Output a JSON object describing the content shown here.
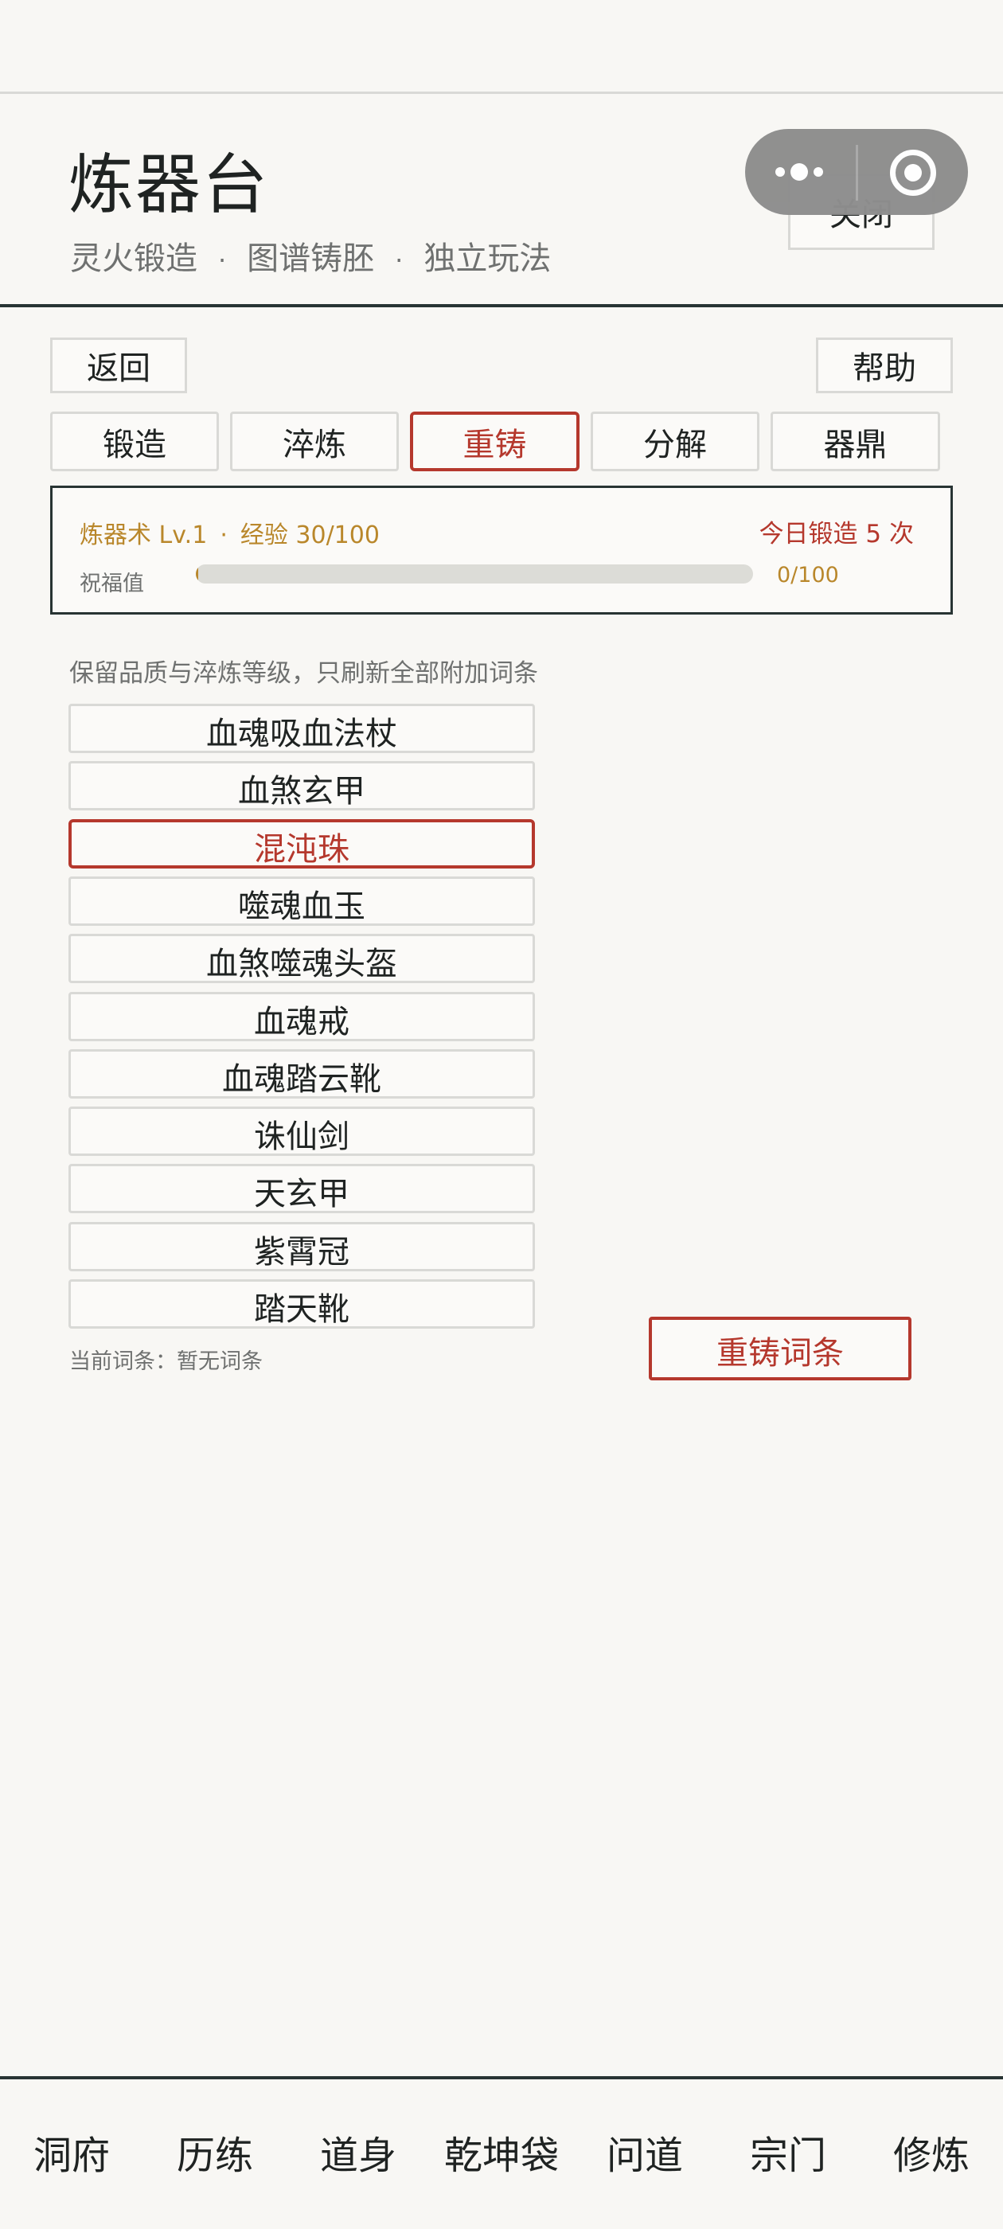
{
  "header": {
    "title": "炼器台",
    "subtitle_parts": [
      "灵火锻造",
      "图谱铸胚",
      "独立玩法"
    ],
    "separator": "·",
    "close_label": "关闭"
  },
  "capsule": {
    "more_icon": "more-dots-icon",
    "close_icon": "target-circle-icon"
  },
  "nav_buttons": {
    "back_label": "返回",
    "help_label": "帮助"
  },
  "tabs": [
    {
      "label": "锻造",
      "active": false
    },
    {
      "label": "淬炼",
      "active": false
    },
    {
      "label": "重铸",
      "active": true
    },
    {
      "label": "分解",
      "active": false
    },
    {
      "label": "器鼎",
      "active": false
    }
  ],
  "status": {
    "skill_level": "炼器术 Lv.1",
    "experience": "经验 30/100",
    "today_forge": "今日锻造 5 次",
    "blessing_label": "祝福值",
    "blessing_value": "0/100",
    "blessing_fraction": 0
  },
  "recast": {
    "hint": "保留品质与淬炼等级，只刷新全部附加词条",
    "items": [
      {
        "label": "血魂吸血法杖",
        "selected": false
      },
      {
        "label": "血煞玄甲",
        "selected": false
      },
      {
        "label": "混沌珠",
        "selected": true
      },
      {
        "label": "噬魂血玉",
        "selected": false
      },
      {
        "label": "血煞噬魂头盔",
        "selected": false
      },
      {
        "label": "血魂戒",
        "selected": false
      },
      {
        "label": "血魂踏云靴",
        "selected": false
      },
      {
        "label": "诛仙剑",
        "selected": false
      },
      {
        "label": "天玄甲",
        "selected": false
      },
      {
        "label": "紫霄冠",
        "selected": false
      },
      {
        "label": "踏天靴",
        "selected": false
      }
    ],
    "current_affix": "当前词条：暂无词条",
    "action_label": "重铸词条"
  },
  "bottom_nav": [
    "洞府",
    "历练",
    "道身",
    "乾坤袋",
    "问道",
    "宗门",
    "修炼"
  ],
  "colors": {
    "accent_red": "#b5382d",
    "gold": "#b9872b",
    "ink": "#283433",
    "background": "#f8f7f4"
  }
}
